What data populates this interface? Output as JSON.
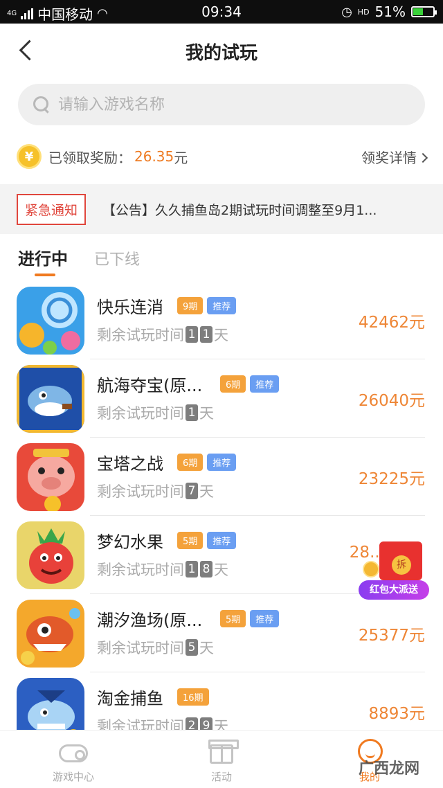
{
  "status_bar": {
    "network": "4G",
    "carrier": "中国移动",
    "time": "09:34",
    "hd_label": "HD",
    "battery": "51%",
    "battery_level": 0.51
  },
  "header": {
    "title": "我的试玩"
  },
  "search": {
    "placeholder": "请输入游戏名称",
    "value": ""
  },
  "reward": {
    "coin_symbol": "¥",
    "label": "已领取奖励：",
    "amount": "26.35",
    "unit": "元",
    "detail_label": "领奖详情"
  },
  "notice": {
    "tag": "紧急通知",
    "text": "【公告】久久捕鱼岛2期试玩时间调整至9月1..."
  },
  "tabs": [
    {
      "label": "进行中",
      "active": true
    },
    {
      "label": "已下线",
      "active": false
    }
  ],
  "games": [
    {
      "name": "快乐连消",
      "period": "9期",
      "recommend": "推荐",
      "remain_prefix": "剩余试玩时间",
      "days_digits": [
        "1",
        "1"
      ],
      "day_unit": "天",
      "amount": "42462元"
    },
    {
      "name": "航海夺宝(原...",
      "period": "6期",
      "recommend": "推荐",
      "remain_prefix": "剩余试玩时间",
      "days_digits": [
        "1"
      ],
      "day_unit": "天",
      "amount": "26040元"
    },
    {
      "name": "宝塔之战",
      "period": "6期",
      "recommend": "推荐",
      "remain_prefix": "剩余试玩时间",
      "days_digits": [
        "7"
      ],
      "day_unit": "天",
      "amount": "23225元"
    },
    {
      "name": "梦幻水果",
      "period": "5期",
      "recommend": "推荐",
      "remain_prefix": "剩余试玩时间",
      "days_digits": [
        "1",
        "8"
      ],
      "day_unit": "天",
      "amount": "28..."
    },
    {
      "name": "潮汐渔场(原...",
      "period": "5期",
      "recommend": "推荐",
      "remain_prefix": "剩余试玩时间",
      "days_digits": [
        "5"
      ],
      "day_unit": "天",
      "amount": "25377元"
    },
    {
      "name": "淘金捕鱼",
      "period": "16期",
      "recommend": "",
      "remain_prefix": "剩余试玩时间",
      "days_digits": [
        "2",
        "9"
      ],
      "day_unit": "天",
      "amount": "8893元"
    }
  ],
  "float_banner": {
    "seal": "拆",
    "label": "红包大派送"
  },
  "tabbar": [
    {
      "label": "游戏中心",
      "icon": "gamepad-icon",
      "active": false
    },
    {
      "label": "活动",
      "icon": "gift-icon",
      "active": false
    },
    {
      "label": "我的",
      "icon": "smile-icon",
      "active": true
    }
  ],
  "watermark": "广西龙网",
  "colors": {
    "accent": "#f07a20",
    "amount": "#ee8636",
    "notice_red": "#e0463c",
    "period_badge": "#f4a23b",
    "recommend_badge": "#6a9ef2"
  }
}
